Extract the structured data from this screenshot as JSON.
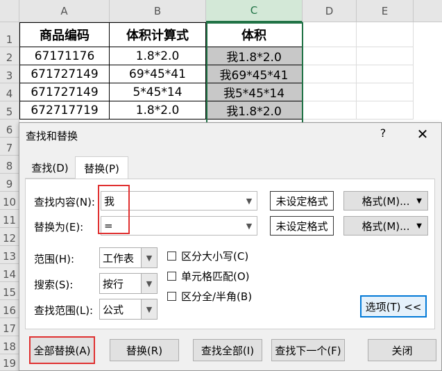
{
  "sheet": {
    "columns": [
      "A",
      "B",
      "C",
      "D",
      "E"
    ],
    "rows": [
      "1",
      "2",
      "3",
      "4",
      "5",
      "6",
      "7",
      "8",
      "9",
      "10",
      "11",
      "12",
      "13",
      "14",
      "15",
      "16",
      "17",
      "18",
      "19"
    ],
    "table": {
      "header": [
        "商品编码",
        "体积计算式",
        "体积"
      ],
      "body": [
        [
          "67171176",
          "1.8*2.0",
          "我1.8*2.0"
        ],
        [
          "671727149",
          "69*45*41",
          "我69*45*41"
        ],
        [
          "671727149",
          "5*45*14",
          "我5*45*14"
        ],
        [
          "672717719",
          "1.8*2.0",
          "我1.8*2.0"
        ]
      ]
    },
    "colors": {
      "selected_column": "#217346",
      "selected_fill": "#c8c8c8",
      "highlight": "#e03030"
    }
  },
  "dialog": {
    "title": "查找和替换",
    "help": "?",
    "close": "✕",
    "tabs": [
      "查找(D)",
      "替换(P)"
    ],
    "find_label": "查找内容(N):",
    "find_value": "我",
    "replace_label": "替换为(E):",
    "replace_value": "=",
    "no_format": "未设定格式",
    "format_button": "格式(M)...",
    "scope_label": "范围(H):",
    "scope_value": "工作表",
    "search_label": "搜索(S):",
    "search_value": "按行",
    "lookin_label": "查找范围(L):",
    "lookin_value": "公式",
    "match_case": "区分大小写(C)",
    "match_cell": "单元格匹配(O)",
    "match_width": "区分全/半角(B)",
    "options_button": "选项(T) <<",
    "replace_all": "全部替换(A)",
    "replace": "替换(R)",
    "find_all": "查找全部(I)",
    "find_next": "查找下一个(F)",
    "close_button": "关闭"
  }
}
